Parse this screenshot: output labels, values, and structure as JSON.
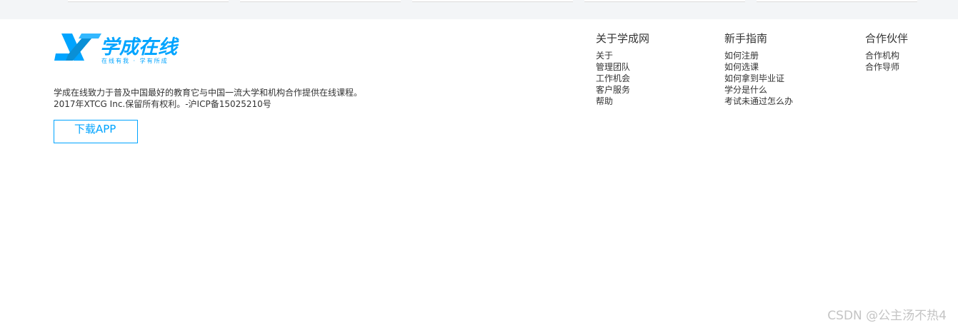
{
  "brand": {
    "name": "学成在线",
    "slogan": "在线有我 · 学有所成",
    "accent_color": "#00a4ff"
  },
  "footer": {
    "description_line1": "学成在线致力于普及中国最好的教育它与中国一流大学和机构合作提供在线课程。",
    "description_line2": "2017年XTCG Inc.保留所有权利。-沪ICP备15025210号",
    "download_label": "下载APP",
    "columns": [
      {
        "title": "关于学成网",
        "links": [
          "关于",
          "管理团队",
          "工作机会",
          "客户服务",
          "帮助"
        ]
      },
      {
        "title": "新手指南",
        "links": [
          "如何注册",
          "如何选课",
          "如何拿到毕业证",
          "学分是什么",
          "考试未通过怎么办"
        ]
      },
      {
        "title": "合作伙伴",
        "links": [
          "合作机构",
          "合作导师"
        ]
      }
    ]
  },
  "watermark": "CSDN @公主汤不热4"
}
